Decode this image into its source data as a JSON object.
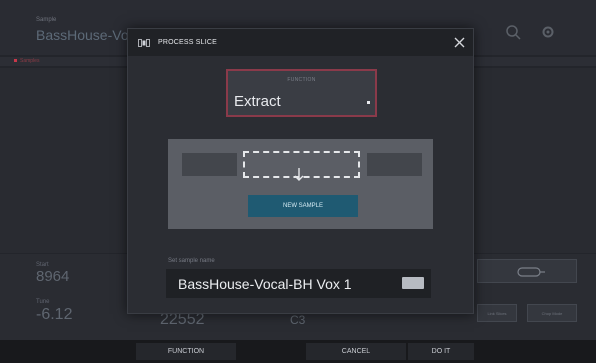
{
  "background": {
    "sample_label": "Sample",
    "sample_name": "BassHouse-Vo",
    "first_tab": "Samples",
    "start_label": "Start",
    "start_value": "8964",
    "tune_label": "Tune",
    "tune_value": "-6.12",
    "length_value": "22552",
    "note_value": "C3",
    "loop_icon": "loop-icon",
    "button_a": "Link Slices",
    "button_b": "Chop Mode"
  },
  "dialog": {
    "icon": "slice-icon",
    "title": "PROCESS SLICE",
    "close_icon": "close-icon",
    "function_label": "FUNCTION",
    "function_value": "Extract",
    "new_sample_label": "NEW SAMPLE",
    "name_label": "Set sample name",
    "name_value": "BassHouse-Vocal-BH Vox 1",
    "keyboard_icon": "keyboard-icon"
  },
  "footer": {
    "function_label": "FUNCTION",
    "cancel_label": "CANCEL",
    "doit_label": "DO IT"
  },
  "colors": {
    "accent_red": "#8a3a4a",
    "new_sample_blue": "#1f5a72"
  }
}
